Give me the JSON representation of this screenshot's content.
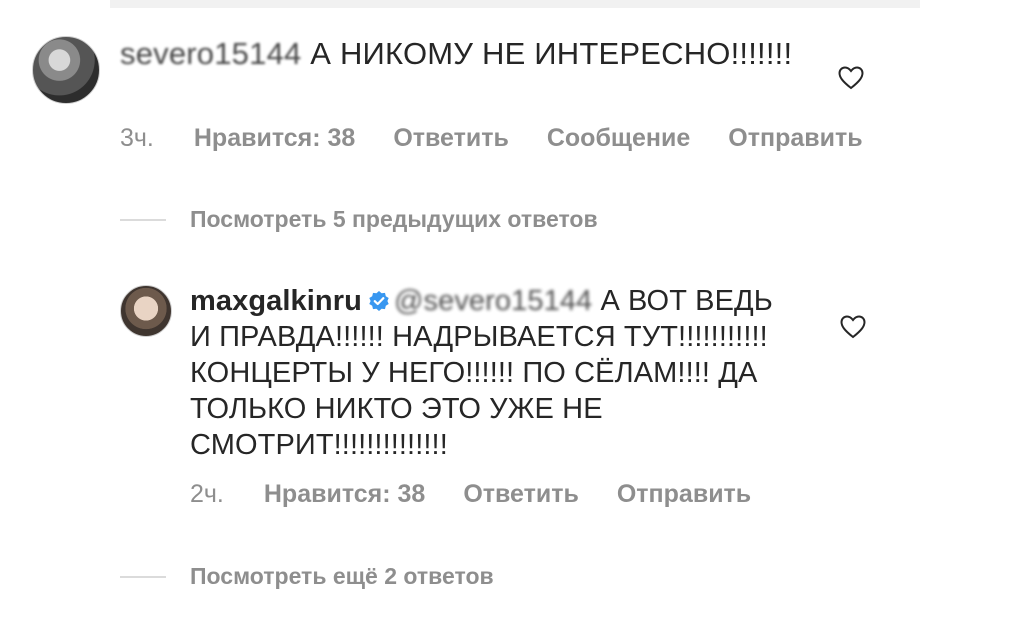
{
  "comment1": {
    "username": "severo15144",
    "text": "А НИКОМУ НЕ ИНТЕРЕСНО!!!!!!!",
    "time": "3ч.",
    "likes": "Нравится: 38",
    "reply": "Ответить",
    "message": "Сообщение",
    "send": "Отправить",
    "like_icon": "heart-outline-icon",
    "avatar_icon": "user-avatar"
  },
  "view_previous": "Посмотреть 5 предыдущих ответов",
  "comment2": {
    "username": "maxgalkinru",
    "verified_icon": "verified-badge-icon",
    "mention": "@severo15144",
    "text": "А ВОТ ВЕДЬ И ПРАВДА!!!!!! НАДРЫВАЕТСЯ ТУТ!!!!!!!!!!! КОНЦЕРТЫ У НЕГО!!!!!! ПО СЁЛАМ!!!! ДА ТОЛЬКО НИКТО ЭТО УЖЕ НЕ СМОТРИТ!!!!!!!!!!!!!!",
    "time": "2ч.",
    "likes": "Нравится: 38",
    "reply": "Ответить",
    "send": "Отправить",
    "like_icon": "heart-outline-icon"
  },
  "view_more": "Посмотреть ещё 2 ответов",
  "colors": {
    "text": "#262626",
    "meta": "#8e8e8e",
    "verified": "#3897f0",
    "divider": "#dbdbdb"
  }
}
